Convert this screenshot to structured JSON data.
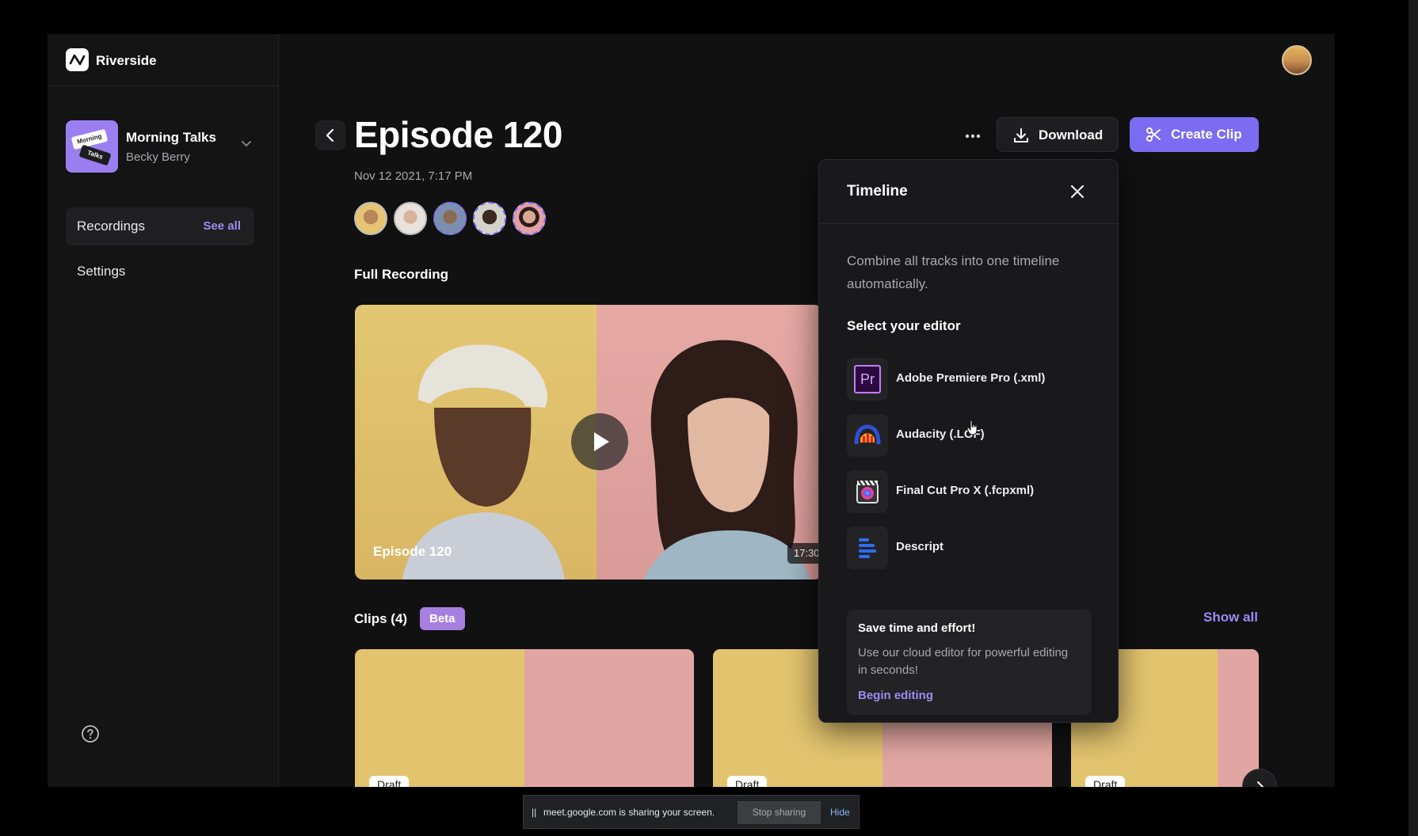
{
  "app": {
    "name": "Riverside"
  },
  "workspace": {
    "thumb_line1": "Morning",
    "thumb_line2": "Talks",
    "name": "Morning Talks",
    "owner": "Becky Berry"
  },
  "nav": {
    "recordings": "Recordings",
    "see_all": "See all",
    "settings": "Settings"
  },
  "episode": {
    "title": "Episode 120",
    "date": "Nov 12 2021, 7:17 PM",
    "participant_count": 5
  },
  "actions": {
    "download": "Download",
    "create_clip": "Create Clip"
  },
  "full_recording": {
    "heading": "Full Recording",
    "video_title": "Episode 120",
    "duration": "17:30"
  },
  "clips": {
    "heading": "Clips (4)",
    "badge": "Beta",
    "show_all": "Show all",
    "draft_label": "Draft"
  },
  "timeline": {
    "title": "Timeline",
    "description": "Combine all tracks into one timeline automatically.",
    "select_heading": "Select your editor",
    "editors": [
      {
        "name": "Adobe Premiere Pro (.xml)",
        "icon": "premiere-pro-icon",
        "icon_text": "Pr"
      },
      {
        "name": "Audacity (.LOF)",
        "icon": "audacity-icon"
      },
      {
        "name": "Final Cut Pro X (.fcpxml)",
        "icon": "final-cut-pro-icon"
      },
      {
        "name": "Descript",
        "icon": "descript-icon"
      }
    ],
    "promo": {
      "title": "Save time and effort!",
      "text": "Use our cloud editor for powerful editing in seconds!",
      "link": "Begin editing"
    }
  },
  "sharebar": {
    "pause": "||",
    "text": "meet.google.com is sharing your screen.",
    "stop": "Stop sharing",
    "hide": "Hide"
  },
  "colors": {
    "accent": "#7b6cf2",
    "link": "#9b8cf2",
    "beta": "#a77fe0",
    "background": "#111112"
  }
}
